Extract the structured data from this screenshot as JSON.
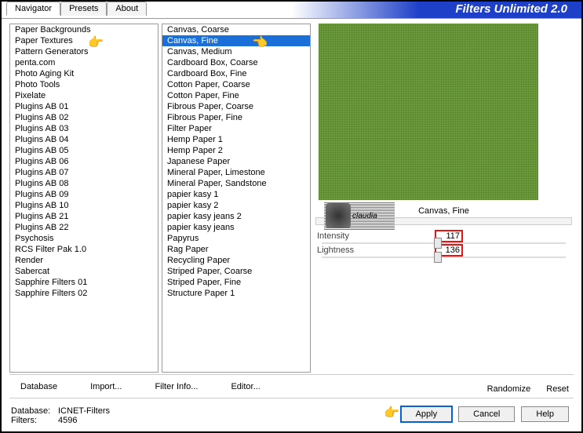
{
  "title": "Filters Unlimited 2.0",
  "tabs": {
    "navigator": "Navigator",
    "presets": "Presets",
    "about": "About"
  },
  "categories": [
    "Paper Backgrounds",
    "Paper Textures",
    "Pattern Generators",
    "penta.com",
    "Photo Aging Kit",
    "Photo Tools",
    "Pixelate",
    "Plugins AB 01",
    "Plugins AB 02",
    "Plugins AB 03",
    "Plugins AB 04",
    "Plugins AB 05",
    "Plugins AB 06",
    "Plugins AB 07",
    "Plugins AB 08",
    "Plugins AB 09",
    "Plugins AB 10",
    "Plugins AB 21",
    "Plugins AB 22",
    "Psychosis",
    "RCS Filter Pak 1.0",
    "Render",
    "Sabercat",
    "Sapphire Filters 01",
    "Sapphire Filters 02"
  ],
  "filters": [
    "Canvas, Coarse",
    "Canvas, Fine",
    "Canvas, Medium",
    "Cardboard Box, Coarse",
    "Cardboard Box, Fine",
    "Cotton Paper, Coarse",
    "Cotton Paper, Fine",
    "Fibrous Paper, Coarse",
    "Fibrous Paper, Fine",
    "Filter Paper",
    "Hemp Paper 1",
    "Hemp Paper 2",
    "Japanese Paper",
    "Mineral Paper, Limestone",
    "Mineral Paper, Sandstone",
    "papier kasy 1",
    "papier kasy 2",
    "papier kasy jeans 2",
    "papier kasy jeans",
    "Papyrus",
    "Rag Paper",
    "Recycling Paper",
    "Striped Paper, Coarse",
    "Striped Paper, Fine",
    "Structure Paper 1"
  ],
  "selected_filter_index": 1,
  "selected_filter_name": "Canvas, Fine",
  "params": {
    "intensity": {
      "label": "Intensity",
      "value": "117"
    },
    "lightness": {
      "label": "Lightness",
      "value": "136"
    }
  },
  "buttons": {
    "database": "Database",
    "import": "Import...",
    "filterinfo": "Filter Info...",
    "editor": "Editor...",
    "randomize": "Randomize",
    "reset": "Reset",
    "apply": "Apply",
    "cancel": "Cancel",
    "help": "Help"
  },
  "status": {
    "db_label": "Database:",
    "db_value": "ICNET-Filters",
    "filters_label": "Filters:",
    "filters_value": "4596"
  },
  "badge": "claudia"
}
